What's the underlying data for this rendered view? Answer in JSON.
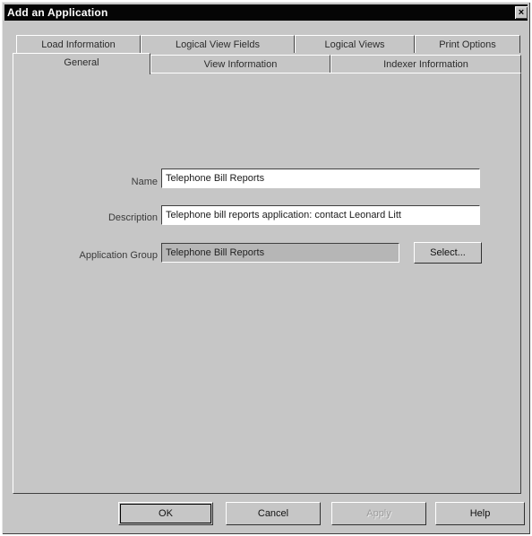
{
  "window": {
    "title": "Add an Application",
    "close_glyph": "×"
  },
  "tabs_row1": [
    "Load Information",
    "Logical View Fields",
    "Logical Views",
    "Print Options"
  ],
  "tabs_row2": [
    "General",
    "View Information",
    "Indexer Information"
  ],
  "form": {
    "name_label": "Name",
    "name_value": "Telephone Bill Reports",
    "description_label": "Description",
    "description_value": "Telephone bill reports application: contact Leonard Litt",
    "group_label": "Application Group",
    "group_value": "Telephone Bill Reports",
    "select_label": "Select..."
  },
  "buttons": {
    "ok": "OK",
    "cancel": "Cancel",
    "apply": "Apply",
    "help": "Help"
  },
  "icons": {
    "close": "close-icon"
  },
  "colors": {
    "titlebar": "#050505",
    "face": "#c6c6c6"
  }
}
